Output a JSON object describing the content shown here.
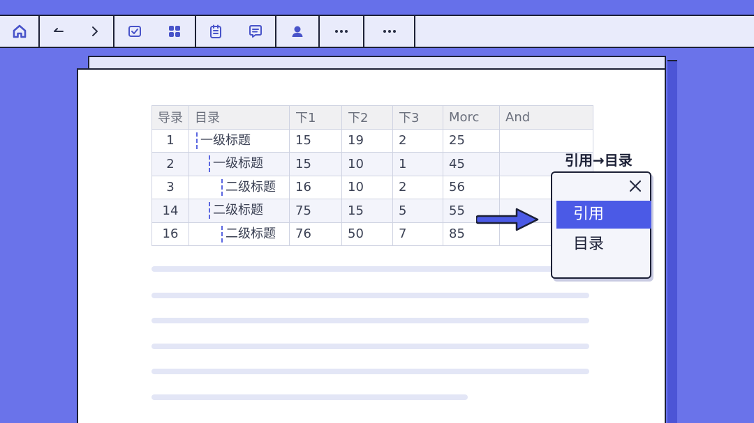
{
  "toolbar": {
    "groups": [
      {
        "buttons": [
          "home-icon"
        ]
      },
      {
        "buttons": [
          "back-arrow-icon",
          "forward-chevron-icon"
        ]
      },
      {
        "buttons": [
          "checkbox-icon",
          "grid-icon"
        ]
      },
      {
        "buttons": [
          "clipboard-icon",
          "comment-icon"
        ]
      },
      {
        "buttons": [
          "user-icon"
        ]
      },
      {
        "buttons": [
          "more-icon"
        ]
      },
      {
        "buttons": [
          "more-icon"
        ]
      }
    ],
    "accent": "#4853c9"
  },
  "table": {
    "headers": [
      "导录",
      "目录",
      "下1",
      "下2",
      "下3",
      "Morc",
      "And"
    ],
    "rows": [
      {
        "idx": "1",
        "title": "一级标题",
        "level": 1,
        "a": "15",
        "b": "19",
        "c": "2",
        "d": "25",
        "e": ""
      },
      {
        "idx": "2",
        "title": "一级标题",
        "level": 2,
        "a": "15",
        "b": "10",
        "c": "1",
        "d": "45",
        "e": ""
      },
      {
        "idx": "3",
        "title": "二级标题",
        "level": 3,
        "a": "16",
        "b": "10",
        "c": "2",
        "d": "56",
        "e": ""
      },
      {
        "idx": "14",
        "title": "二级标题",
        "level": 2,
        "a": "75",
        "b": "15",
        "c": "5",
        "d": "55",
        "e": ""
      },
      {
        "idx": "16",
        "title": "二级标题",
        "level": 3,
        "a": "76",
        "b": "50",
        "c": "7",
        "d": "85",
        "e": ""
      }
    ]
  },
  "popup": {
    "caption": "引用→目录",
    "close_icon": "close-icon",
    "items": [
      "引用",
      "目录"
    ],
    "selected_index": 0,
    "selected_color": "#4b5ae6"
  },
  "colors": {
    "background": "#6a73ea",
    "paper": "#ffffff",
    "outline": "#1c2036"
  }
}
